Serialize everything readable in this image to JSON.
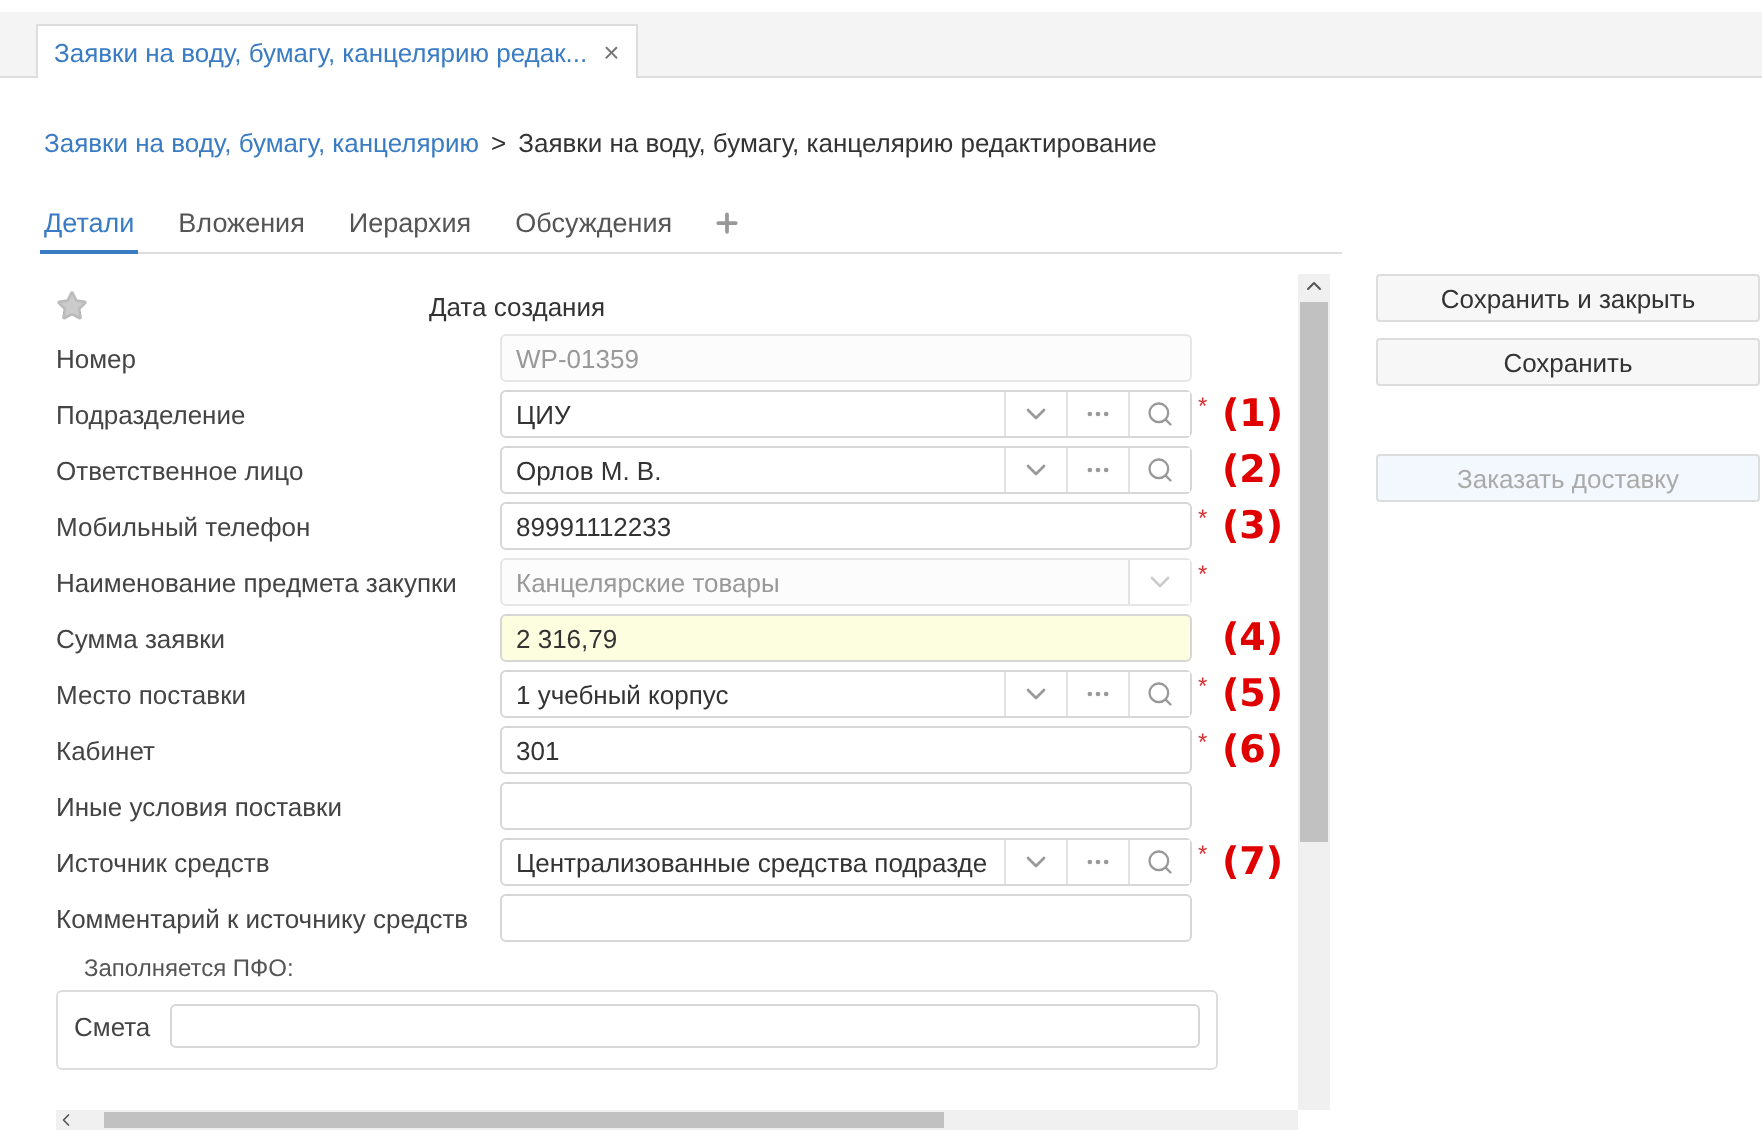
{
  "doc_tab": {
    "title": "Заявки на воду, бумагу, канцелярию редак...",
    "close": "×"
  },
  "breadcrumb": {
    "link": "Заявки на воду, бумагу, канцелярию",
    "separator": ">",
    "current": "Заявки на воду, бумагу, канцелярию редактирование"
  },
  "tabs": [
    {
      "label": "Детали",
      "selected": true
    },
    {
      "label": "Вложения",
      "selected": false
    },
    {
      "label": "Иерархия",
      "selected": false
    },
    {
      "label": "Обсуждения",
      "selected": false
    }
  ],
  "header": {
    "favorite": false,
    "title": "Дата создания"
  },
  "required_symbol": "*",
  "fields": [
    {
      "label": "Номер",
      "kind": "text",
      "value": "WP-01359",
      "disabled": true,
      "required": false,
      "highlighted": false
    },
    {
      "label": "Подразделение",
      "kind": "lookup",
      "value": "ЦИУ",
      "disabled": false,
      "required": true,
      "highlighted": false,
      "annotation": "(1)"
    },
    {
      "label": "Ответственное лицо",
      "kind": "lookup",
      "value": "Орлов М. В.",
      "disabled": false,
      "required": false,
      "highlighted": false,
      "annotation": "(2)"
    },
    {
      "label": "Мобильный телефон",
      "kind": "text",
      "value": "89991112233",
      "disabled": false,
      "required": true,
      "highlighted": false,
      "annotation": "(3)"
    },
    {
      "label": "Наименование предмета закупки",
      "kind": "select",
      "value": "Канцелярские товары",
      "disabled": true,
      "required": true,
      "highlighted": false
    },
    {
      "label": "Сумма заявки",
      "kind": "text",
      "value": "2 316,79",
      "disabled": false,
      "required": false,
      "highlighted": true,
      "annotation": "(4)"
    },
    {
      "label": "Место поставки",
      "kind": "lookup",
      "value": "1 учебный корпус",
      "disabled": false,
      "required": true,
      "highlighted": false,
      "annotation": "(5)"
    },
    {
      "label": "Кабинет",
      "kind": "text",
      "value": "301",
      "disabled": false,
      "required": true,
      "highlighted": false,
      "annotation": "(6)"
    },
    {
      "label": "Иные условия поставки",
      "kind": "text",
      "disabled": false,
      "required": false,
      "highlighted": false
    },
    {
      "label": "Источник средств",
      "kind": "lookup",
      "value": "Централизованные средства подразде",
      "disabled": false,
      "required": true,
      "highlighted": false,
      "annotation": "(7)"
    },
    {
      "label": "Комментарий к источнику средств",
      "kind": "text",
      "disabled": false,
      "required": false,
      "highlighted": false
    }
  ],
  "pfo_group": {
    "caption": "Заполняется ПФО:",
    "fields": [
      {
        "label": "Смета"
      }
    ]
  },
  "buttons": [
    {
      "label": "Сохранить и закрыть",
      "disabled": false
    },
    {
      "label": "Сохранить",
      "disabled": false
    },
    {
      "label": "Заказать доставку",
      "disabled": true
    }
  ]
}
